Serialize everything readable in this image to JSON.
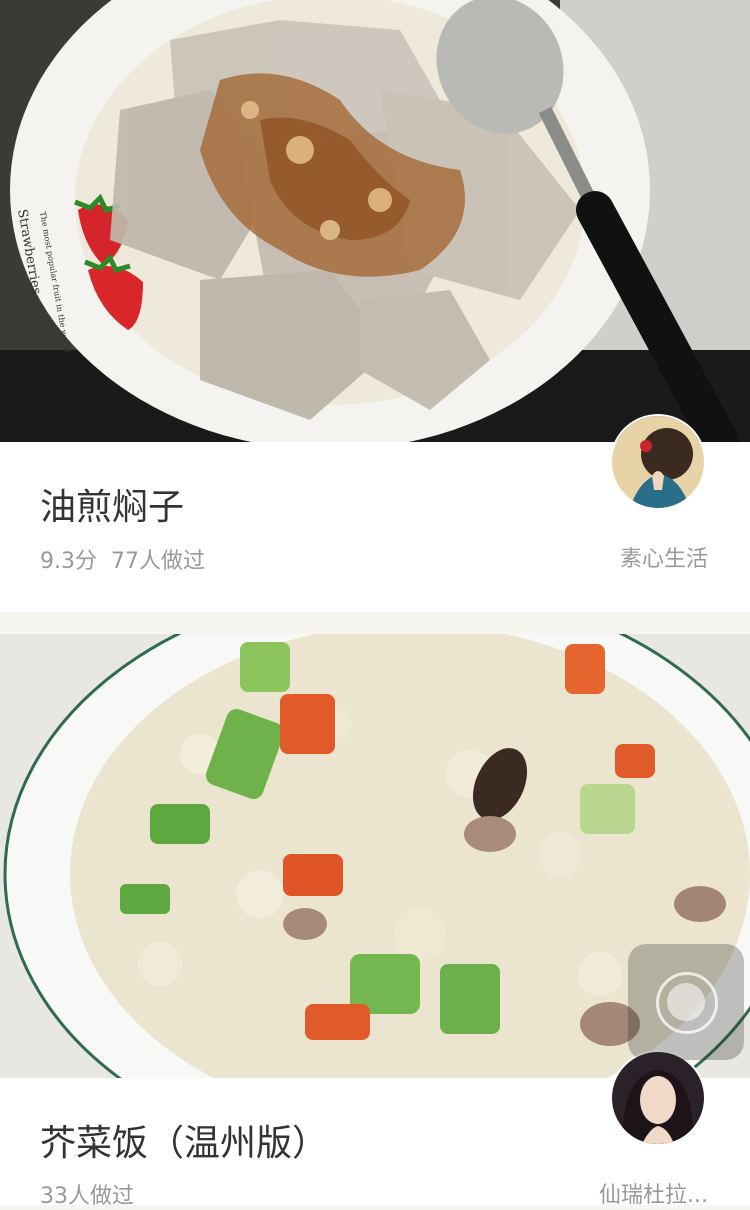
{
  "recipes": [
    {
      "title": "油煎焖子",
      "score": "9.3分",
      "made_count": "77人做过",
      "author": "素心生活",
      "photo_icon": "food-photo-jelly",
      "plate_text_1": "Strawberries",
      "plate_text_2": "The most popular fruit in the world"
    },
    {
      "title": "芥菜饭（温州版）",
      "made_count": "33人做过",
      "author": "仙瑞杜拉...",
      "photo_icon": "food-photo-rice"
    }
  ],
  "colors": {
    "page_bg": "#f7f5ef",
    "title": "#333333",
    "meta": "#999999"
  }
}
